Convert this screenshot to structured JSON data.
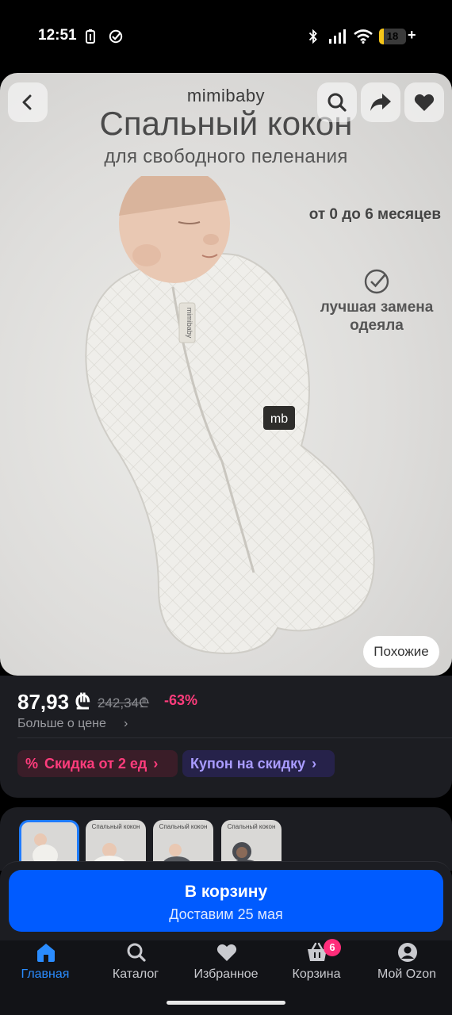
{
  "status_bar": {
    "time": "12:51",
    "battery_level": "18",
    "battery_fraction": 0.18,
    "plus": "+",
    "icons": [
      "battery-saver-icon",
      "check-circle-icon",
      "bluetooth-icon",
      "signal-icon",
      "wifi-icon",
      "battery-icon"
    ]
  },
  "product_image": {
    "brand": "mimibaby",
    "title": "Спальный кокон",
    "subtitle": "для свободного пеленания",
    "age_range": "от 0 до 6 месяцев",
    "replacement_text_line1": "лучшая замена",
    "replacement_text_line2": "одеяла",
    "zipper_tag": "mimibaby",
    "patch_logo": "mb",
    "similar_button": "Похожие"
  },
  "price": {
    "current": "87,93 ₾",
    "old": "242,34₾",
    "discount": "-63%",
    "more_link": "Больше о цене",
    "chevron": "›"
  },
  "promo_chips": {
    "sale_icon": "%",
    "sale_label": "Скидка от 2 ед",
    "coupon_label": "Купон на скидку",
    "chevron": "›"
  },
  "thumbnails": {
    "items": [
      {
        "caption": ""
      },
      {
        "caption": "Спальный кокон"
      },
      {
        "caption": "Спальный кокон"
      },
      {
        "caption": "Спальный кокон"
      }
    ]
  },
  "cart_button": {
    "label": "В корзину",
    "delivery": "Доставим 25 мая"
  },
  "bottom_nav": {
    "items": [
      {
        "label": "Главная",
        "icon": "home-icon"
      },
      {
        "label": "Каталог",
        "icon": "search-icon"
      },
      {
        "label": "Избранное",
        "icon": "heart-icon"
      },
      {
        "label": "Корзина",
        "icon": "basket-icon"
      },
      {
        "label": "Мой Ozon",
        "icon": "profile-icon"
      }
    ],
    "cart_count": "6"
  },
  "colors": {
    "accent": "#005bff",
    "discount": "#ff3c7c",
    "coupon": "#a99cff",
    "background": "#1c1d22"
  }
}
